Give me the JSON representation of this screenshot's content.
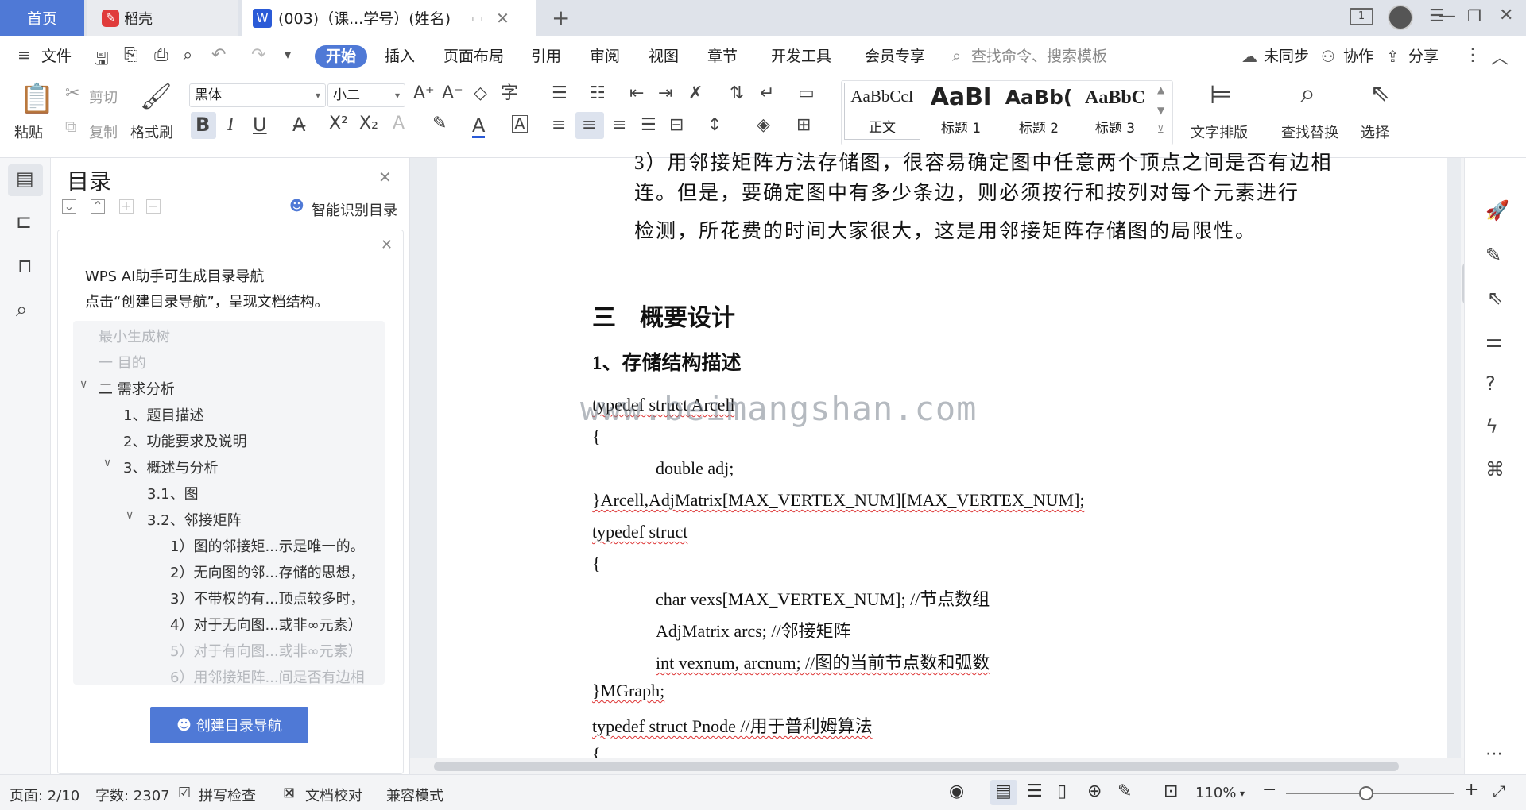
{
  "tabs": {
    "home": "首页",
    "daoke": "稻壳",
    "doc": "(003)（课...学号）(姓名)",
    "new_tab": "+"
  },
  "window": {
    "page_count_badge": "1"
  },
  "menu": {
    "file": "文件",
    "items": [
      "开始",
      "插入",
      "页面布局",
      "引用",
      "审阅",
      "视图",
      "章节",
      "开发工具",
      "会员专享"
    ],
    "search_placeholder": "查找命令、搜索模板",
    "unsynced": "未同步",
    "collaborate": "协作",
    "share": "分享"
  },
  "ribbon": {
    "paste": "粘贴",
    "cut": "剪切",
    "copy": "复制",
    "format_painter": "格式刷",
    "font_name": "黑体",
    "font_size": "小二",
    "styles": [
      {
        "preview": "AaBbCcI",
        "label": "正文"
      },
      {
        "preview": "AaBl",
        "label": "标题 1"
      },
      {
        "preview": "AaBb(",
        "label": "标题 2"
      },
      {
        "preview": "AaBbC",
        "label": "标题 3"
      }
    ],
    "text_layout": "文字排版",
    "find_replace": "查找替换",
    "select": "选择"
  },
  "nav": {
    "title": "目录",
    "smart_toc": "智能识别目录",
    "ai_line1": "WPS AI助手可生成目录导航",
    "ai_line2": "点击“创建目录导航”，呈现文档结构。",
    "toc": [
      {
        "text": "最小生成树",
        "dim": true
      },
      {
        "text": "一  目的",
        "dim": true
      },
      {
        "text": "二  需求分析",
        "dim": false
      },
      {
        "text": "1、题目描述",
        "dim": false
      },
      {
        "text": "2、功能要求及说明",
        "dim": false
      },
      {
        "text": "3、概述与分析",
        "dim": false
      },
      {
        "text": "3.1、图",
        "dim": false
      },
      {
        "text": "3.2、邻接矩阵",
        "dim": false
      },
      {
        "text": "1）图的邻接矩...示是唯一的。",
        "dim": false
      },
      {
        "text": "2）无向图的邻...存储的思想，",
        "dim": false
      },
      {
        "text": "3）不带权的有...顶点较多时，",
        "dim": false
      },
      {
        "text": "4）对于无向图...或非∞元素）",
        "dim": false
      },
      {
        "text": "5）对于有向图...或非∞元素）",
        "dim": true
      },
      {
        "text": "6）用邻接矩阵...间是否有边相",
        "dim": true
      }
    ],
    "create_button": "创建目录导航"
  },
  "document": {
    "partial_top": "3）用邻接矩阵方法存储图，很容易确定图中任意两个顶点之间是否有边相",
    "line1": "连。但是，要确定图中有多少条边，则必须按行和按列对每个元素进行",
    "line2": "检测，所花费的时间大家很大，这是用邻接矩阵存储图的局限性。",
    "heading3": "三    概要设计",
    "subheading": "1、存储结构描述",
    "code": [
      "typedef struct Arcell",
      "{",
      "double adj;",
      "}Arcell,AdjMatrix[MAX_VERTEX_NUM][MAX_VERTEX_NUM];",
      "typedef struct",
      "{",
      "char vexs[MAX_VERTEX_NUM]; //节点数组",
      "AdjMatrix arcs; //邻接矩阵",
      "int vexnum, arcnum; //图的当前节点数和弧数",
      "}MGraph;",
      "typedef struct Pnode //用于普利姆算法",
      "{"
    ],
    "watermark": "www.beimangshan.com"
  },
  "status": {
    "page": "页面: 2/10",
    "words": "字数: 2307",
    "spell": "拼写检查",
    "proof": "文档校对",
    "compat": "兼容模式",
    "zoom": "110%"
  },
  "colors": {
    "accent": "#4f79d6",
    "tabbar": "#dfe3ea"
  }
}
